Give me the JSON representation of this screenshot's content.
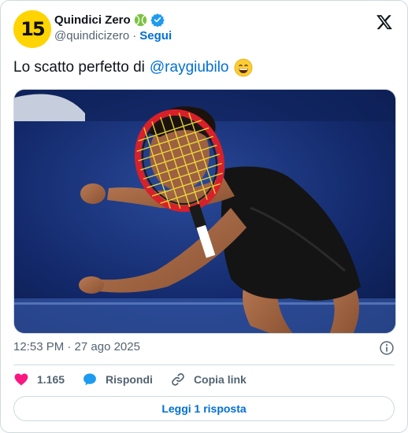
{
  "account": {
    "avatar_text": "15",
    "name": "Quindici Zero",
    "handle": "@quindicizero",
    "separator": "·",
    "follow_label": "Segui"
  },
  "tweet": {
    "text": "Lo scatto perfetto di",
    "mention": "@raygiubilo",
    "emoji": "grinning-face-emoji"
  },
  "meta": {
    "timestamp": "12:53 PM · 27 ago 2025"
  },
  "actions": {
    "likes": "1.165",
    "reply_label": "Rispondi",
    "copy_label": "Copia link"
  },
  "read_replies_label": "Leggi 1 risposta",
  "colors": {
    "link": "#006fd6",
    "verified": "#1d9bf0",
    "heart": "#f91880",
    "avatar_bg": "#ffd400"
  },
  "icons": [
    "tennis-ball-icon",
    "verified-badge-icon",
    "x-logo-icon",
    "info-icon",
    "heart-icon",
    "reply-bubble-icon",
    "link-icon"
  ]
}
